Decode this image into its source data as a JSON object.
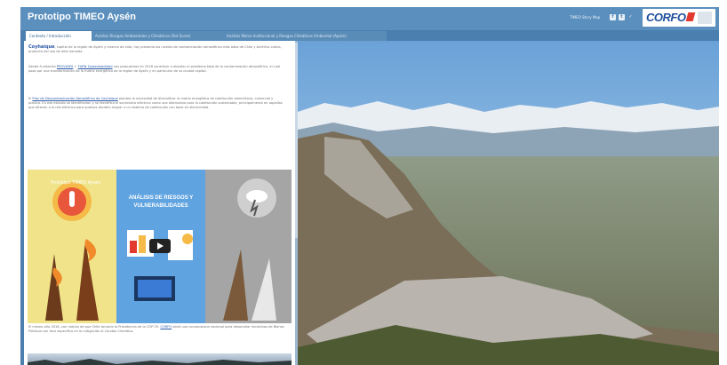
{
  "header": {
    "title": "Prototipo TIMEO Aysén",
    "story_link": "TIMEO Story Map",
    "social": [
      "f",
      "t",
      "✓"
    ],
    "logo_text": "CORFO"
  },
  "tabs": [
    {
      "label": "Contexto / Introducción",
      "active": true
    },
    {
      "label": "Análisis Riesgos Ambientales y Climáticos (Rot Score)",
      "active": false
    },
    {
      "label": "Análisis Marco Institucional y Riesgos Climáticos Ambiental (Aysén)",
      "active": false
    }
  ],
  "intro": {
    "keyword": "Coyhaique",
    "text1": ", capital de la región de Aysén y reserva de vida, hoy presenta los niveles de contaminación atmosférica más altos de Chile y América Latina, producto del uso de leña húmeda.",
    "text2a": "Desde Fundación ",
    "link_a": "PROVIDES",
    "text2b": " + ",
    "link_b": "FURN Sustentabilidad",
    "text2c": " nos propusimos en 2016 contribuir a abordar el problema total de la contaminación atmosférica, el cual pasa por una transformación de la matriz energética de la región de Aysén y en particular de su ciudad capital.",
    "text3a": "El ",
    "link_plan": "Plan de Descontaminación Atmosférica de Coyhaique",
    "text3b": " plantea la necesidad de diversificar la matriz energética de calefacción domiciliaria, comercial y pública. En ese estudio se identificaron y se identifica el suministro eléctrico como una alternativa para la calefacción sustentable, principalmente en aquellas que ofrecen a la red eléctrica para quienes deciden migrar a un sistema de calefacción con base en electricidad.",
    "text4a": "El mismo año 2016, con motivo de que Chile tomaría la Presidencia de la COP 25, ",
    "link_corfo": "CORFO",
    "text4b": " abrió una convocatoria nacional para desarrollar Iniciativas de Bienes Públicos con foco específico en la mitigación al Cambio Climático."
  },
  "video": {
    "title": "Prototipo TIMEO Aysén",
    "panel_title": "ANÁLISIS DE RIESGOS Y VULNERABILIDADES"
  },
  "colors": {
    "header_bg": "#5b8fbd",
    "frame_bg": "#4a7fb0",
    "link": "#2a58a6",
    "corfo_blue": "#1f4f9c",
    "corfo_red": "#e23a2e"
  }
}
